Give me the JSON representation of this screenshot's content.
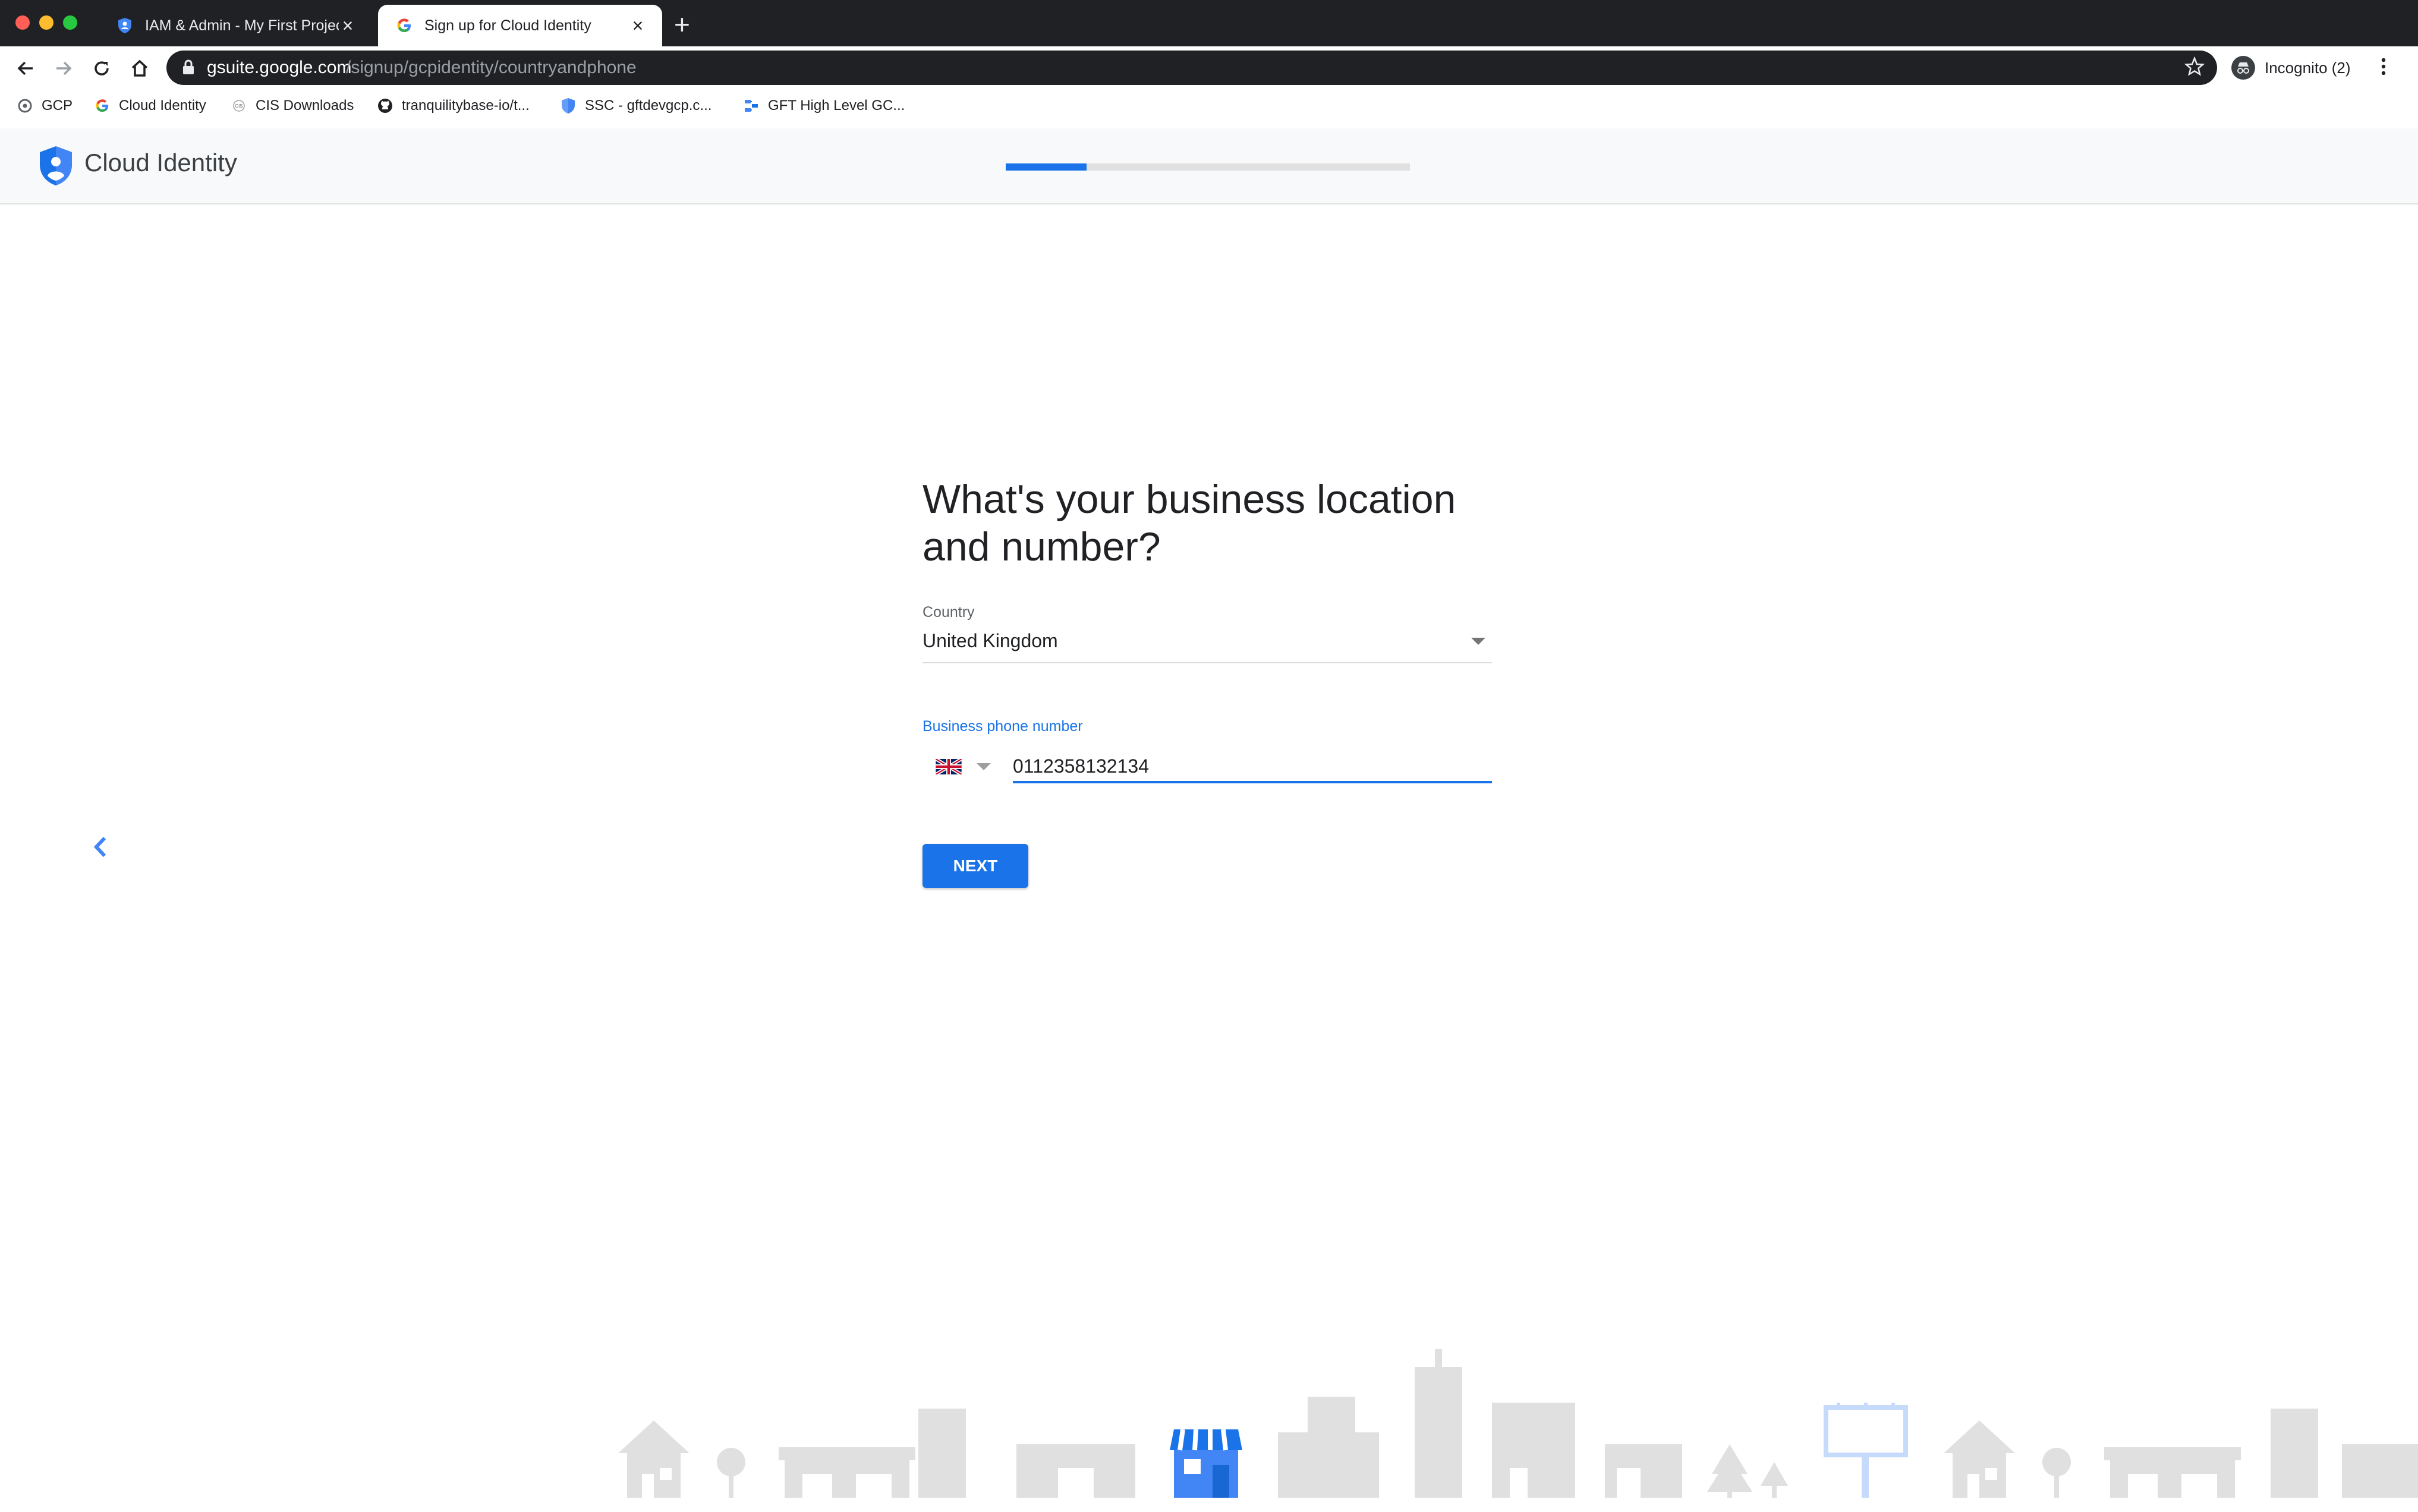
{
  "browser": {
    "tabs": [
      {
        "title": "IAM & Admin - My First Project -",
        "active": false
      },
      {
        "title": "Sign up for Cloud Identity",
        "active": true
      }
    ],
    "url": {
      "host": "gsuite.google.com",
      "path": "/signup/gcpidentity/countryandphone"
    },
    "profile_label": "Incognito (2)",
    "bookmarks": [
      {
        "label": "GCP",
        "icon": "gcp-icon"
      },
      {
        "label": "Cloud Identity",
        "icon": "google-g-icon"
      },
      {
        "label": "CIS Downloads",
        "icon": "cis-icon"
      },
      {
        "label": "tranquilitybase-io/t...",
        "icon": "github-icon"
      },
      {
        "label": "SSC - gftdevgcp.c...",
        "icon": "shield-icon"
      },
      {
        "label": "GFT High Level GC...",
        "icon": "diagram-icon"
      }
    ]
  },
  "app": {
    "title": "Cloud Identity",
    "progress": 0.2,
    "colors": {
      "accent": "#1a73e8",
      "header_bg": "#f8f9fa",
      "skyline": "#e0e0e0"
    }
  },
  "form": {
    "heading": "What's your business location and number?",
    "country_label": "Country",
    "country_value": "United Kingdom",
    "phone_label": "Business phone number",
    "phone_value": "0112358132134",
    "next_label": "NEXT"
  }
}
